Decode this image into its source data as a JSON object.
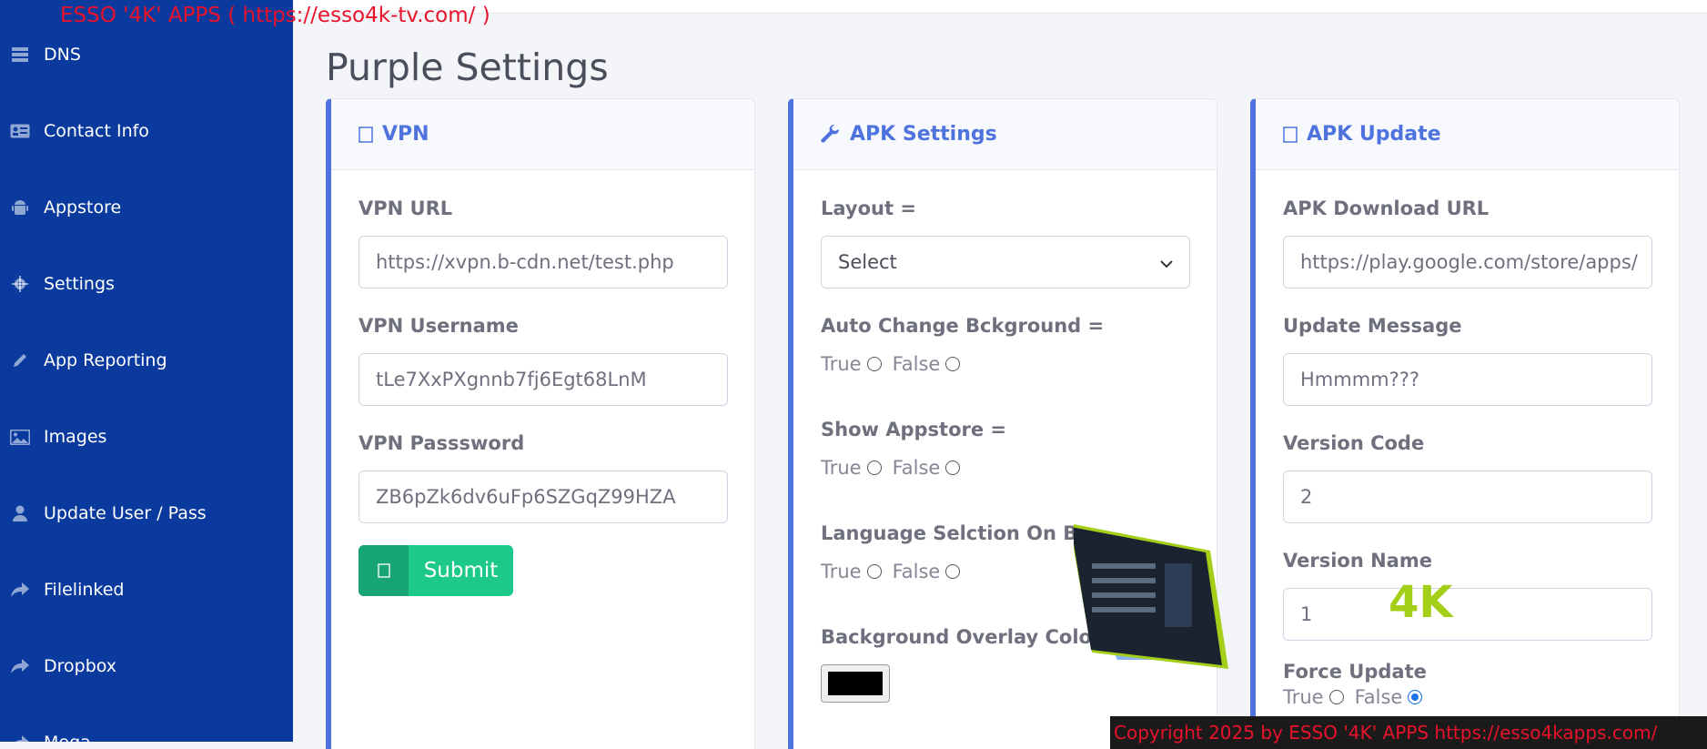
{
  "banner": "ESSO '4K' APPS ( https://esso4k-tv.com/ )",
  "page_title": "Purple Settings",
  "sidebar": {
    "items": [
      {
        "label": "DNS",
        "icon": "server-icon"
      },
      {
        "label": "Contact Info",
        "icon": "id-card-icon"
      },
      {
        "label": "Appstore",
        "icon": "android-icon"
      },
      {
        "label": "Settings",
        "icon": "gear-icon"
      },
      {
        "label": "App Reporting",
        "icon": "pencil-icon"
      },
      {
        "label": "Images",
        "icon": "image-icon"
      },
      {
        "label": "Update User / Pass",
        "icon": "user-icon"
      },
      {
        "label": "Filelinked",
        "icon": "share-icon"
      },
      {
        "label": "Dropbox",
        "icon": "share-icon"
      },
      {
        "label": "Mega",
        "icon": "share-icon"
      }
    ]
  },
  "vpn_card": {
    "title": "VPN",
    "url_label": "VPN URL",
    "url_value": "https://xvpn.b-cdn.net/test.php",
    "username_label": "VPN Username",
    "username_value": "tLe7XxPXgnnb7fj6Egt68LnM",
    "password_label": "VPN Passsword",
    "password_value": "ZB6pZk6dv6uFp6SZGqZ99HZA",
    "submit_label": "Submit"
  },
  "apk_settings_card": {
    "title": "APK Settings",
    "layout_label": "Layout =",
    "layout_value": "Select",
    "auto_bg_label": "Auto Change Bckground =",
    "show_appstore_label": "Show Appstore =",
    "language_label": "Language Selction On Bo",
    "overlay_label": "Background Overlay Colour",
    "overlay_colour": "#000000",
    "true_label": "True",
    "false_label": "False"
  },
  "apk_update_card": {
    "title": "APK Update",
    "download_label": "APK Download URL",
    "download_value": "https://play.google.com/store/apps/",
    "message_label": "Update Message",
    "message_value": "Hmmmm???",
    "version_code_label": "Version Code",
    "version_code_value": "2",
    "version_name_label": "Version Name",
    "version_name_value": "1",
    "force_label": "Force Update",
    "true_label": "True",
    "false_label": "False",
    "force_selected": "False"
  },
  "overlay_badge": "4K",
  "footer": "Copyright 2025  by ESSO '4K' APPS https://esso4kapps.com/",
  "colors": {
    "sidebar_bg": "#0a3a9e",
    "accent": "#4e73df",
    "submit": "#1cc88a",
    "banner_red": "#e8122b"
  }
}
